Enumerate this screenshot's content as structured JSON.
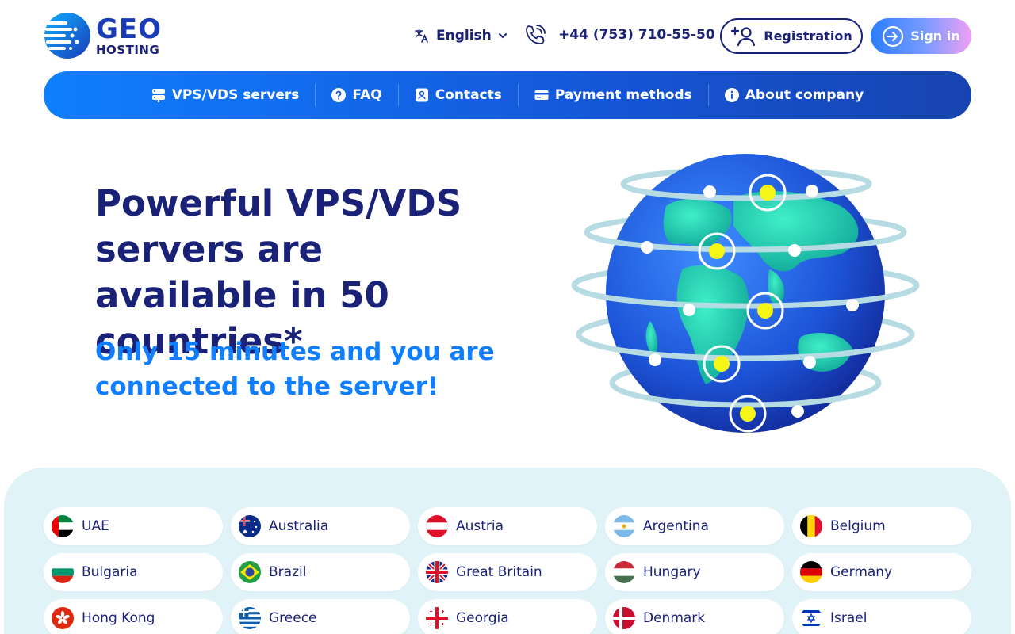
{
  "header": {
    "logo_main": "GEO",
    "logo_sub": "HOSTING",
    "language": "English",
    "phone": "+44 (753) 710-55-50",
    "registration_label": "Registration",
    "signin_label": "Sign in"
  },
  "nav": {
    "items": [
      {
        "label": "VPS/VDS servers",
        "icon": "server-icon"
      },
      {
        "label": "FAQ",
        "icon": "question-icon"
      },
      {
        "label": "Contacts",
        "icon": "contact-card-icon"
      },
      {
        "label": "Payment methods",
        "icon": "credit-card-icon"
      },
      {
        "label": "About company",
        "icon": "info-icon"
      }
    ]
  },
  "hero": {
    "title": "Powerful VPS/VDS servers are available in 50 countries*",
    "subtitle": "Only 15 minutes and you are connected to the server!"
  },
  "countries": [
    {
      "name": "UAE"
    },
    {
      "name": "Australia"
    },
    {
      "name": "Austria"
    },
    {
      "name": "Argentina"
    },
    {
      "name": "Belgium"
    },
    {
      "name": "Bulgaria"
    },
    {
      "name": "Brazil"
    },
    {
      "name": "Great Britain"
    },
    {
      "name": "Hungary"
    },
    {
      "name": "Germany"
    },
    {
      "name": "Hong Kong"
    },
    {
      "name": "Greece"
    },
    {
      "name": "Georgia"
    },
    {
      "name": "Denmark"
    },
    {
      "name": "Israel"
    }
  ],
  "colors": {
    "brand_dark": "#1a2278",
    "brand_blue": "#0f7fff",
    "section_bg": "#dff3f8"
  }
}
